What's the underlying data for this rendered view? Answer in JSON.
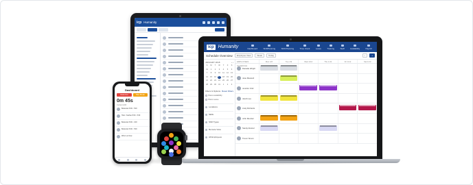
{
  "laptop": {
    "logo": "icp",
    "brand": "Humanity",
    "nav": [
      "Dashboard",
      "ShiftPlanning",
      "Shift Planning",
      "Time Clock",
      "Leave",
      "Training",
      "Staff",
      "Availability",
      "Payroll"
    ],
    "toolbar": {
      "title": "Schedule Overview",
      "employee_view": "Employee View",
      "week": "Week",
      "today": "Today"
    },
    "calendar": {
      "month": "JANUARY 2018",
      "weekdays": [
        "S",
        "M",
        "T",
        "W",
        "T",
        "F",
        "S"
      ],
      "days": [
        "31",
        "1",
        "2",
        "3",
        "4",
        "5",
        "6",
        "7",
        "8",
        "9",
        "10",
        "11",
        "12",
        "13",
        "14",
        "15",
        "16",
        "17",
        "18",
        "19",
        "20",
        "21",
        "22",
        "23",
        "24",
        "25",
        "26",
        "27",
        "28",
        "29",
        "30",
        "31",
        "1",
        "2",
        "3"
      ],
      "today_index": 17
    },
    "filters": {
      "section": "Filters & Options",
      "reset": "Reset Filters",
      "options": [
        "Show availability",
        "Show Leave"
      ]
    },
    "sections": [
      "Locations",
      "Skills",
      "Shift Types",
      "Remote View",
      "All Employees"
    ],
    "grid_days": [
      "Mon 1/8",
      "Tue 1/9",
      "Wed 1/10",
      "Thu 1/11",
      "Fri 1/12",
      "Sat 1/13"
    ],
    "grid_first": "EMPLOYEES SCHEDULE",
    "employees": [
      "Danielle Wright",
      "Jane Maxwell",
      "Jennifer Ortiz",
      "Jacob Lee",
      "Andy Richards",
      "John Mendez",
      "Sandy Alvarez",
      "Trevor Simon"
    ],
    "shift_colors": {
      "grey": "#d9dde3",
      "lime": "#d8ef5a",
      "purple": "#8d33c9",
      "magenta": "#b3174a",
      "yellow": "#f1e43c",
      "orange": "#f3a313",
      "lavender": "#d8d8f3"
    }
  },
  "phone": {
    "header": "Dashboard",
    "btn_left": "Clock Out",
    "btn_right": "Take Break",
    "clock": "0m 45s",
    "sub": "Current shift",
    "items": [
      "Bartender 8:00 - 5:00",
      "Host / Cashier 8:00 - 5:00",
      "Bartender 8:00 - 4:00",
      "Bartender 8:00 - 5:00",
      "Who's on Now"
    ],
    "colors": {
      "left": "#e0453f",
      "right": "#f3a313"
    }
  },
  "tablet": {
    "logo": "icp",
    "brand": "Humanity"
  }
}
